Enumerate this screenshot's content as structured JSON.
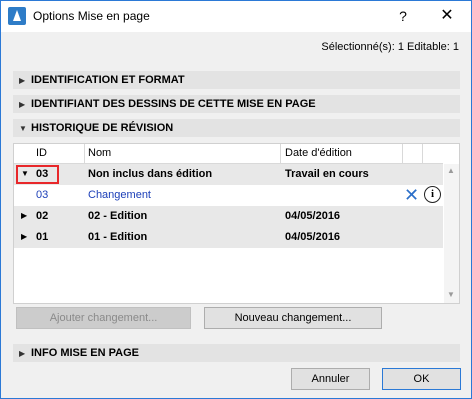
{
  "window": {
    "title": "Options Mise en page",
    "help_label": "?",
    "close_label": "✕"
  },
  "selection_info": "Sélectionné(s): 1 Editable: 1",
  "sections": {
    "identification": "IDENTIFICATION ET FORMAT",
    "drawing_ids": "IDENTIFIANT DES DESSINS DE CETTE MISE EN PAGE",
    "revision_history": "HISTORIQUE DE RÉVISION",
    "info": "INFO MISE EN PAGE"
  },
  "table": {
    "columns": [
      "ID",
      "Nom",
      "Date d'édition"
    ],
    "rows": [
      {
        "id": "03",
        "name": "Non inclus dans édition",
        "date": "Travail en cours",
        "expanded": true
      },
      {
        "id": "03",
        "name": "Changement",
        "date": "",
        "child": true
      },
      {
        "id": "02",
        "name": "02 - Edition",
        "date": "04/05/2016",
        "expanded": false
      },
      {
        "id": "01",
        "name": "01 - Edition",
        "date": "04/05/2016",
        "expanded": false
      }
    ]
  },
  "buttons": {
    "add_change": "Ajouter changement...",
    "new_change": "Nouveau changement...",
    "cancel": "Annuler",
    "ok": "OK"
  },
  "icons": {
    "collapsed": "▶",
    "expanded": "▼",
    "remove": "✕",
    "info": "i"
  },
  "colors": {
    "accent": "#2b79d6",
    "highlight_border": "#e8272a",
    "link_blue": "#1c3fb8"
  }
}
